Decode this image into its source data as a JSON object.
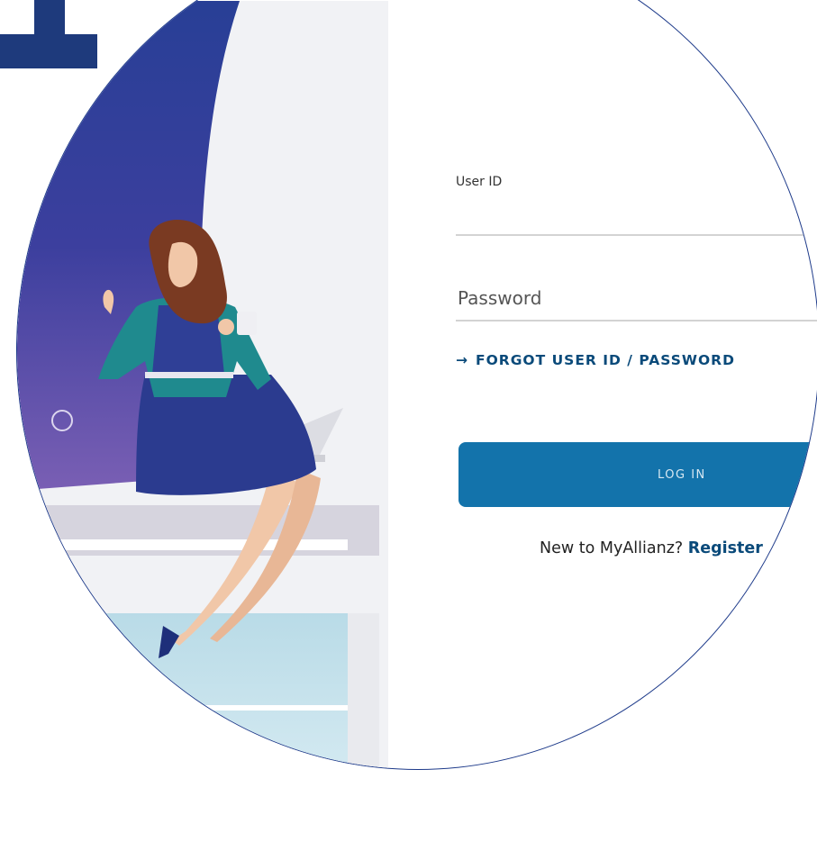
{
  "form": {
    "userid_label": "User ID",
    "userid_value": "",
    "password_placeholder": "Password",
    "forgot_link": "FORGOT USER ID / PASSWORD",
    "login_button": "LOG IN",
    "register_prompt": "New to MyAllianz?",
    "register_link": "Register"
  },
  "icons": {
    "forgot_arrow": "arrow-right-icon"
  },
  "colors": {
    "brand_blue": "#1373ab",
    "link_blue": "#0a4a7a",
    "frame_navy": "#1d3a8a",
    "logo_navy": "#1e3a7c"
  }
}
